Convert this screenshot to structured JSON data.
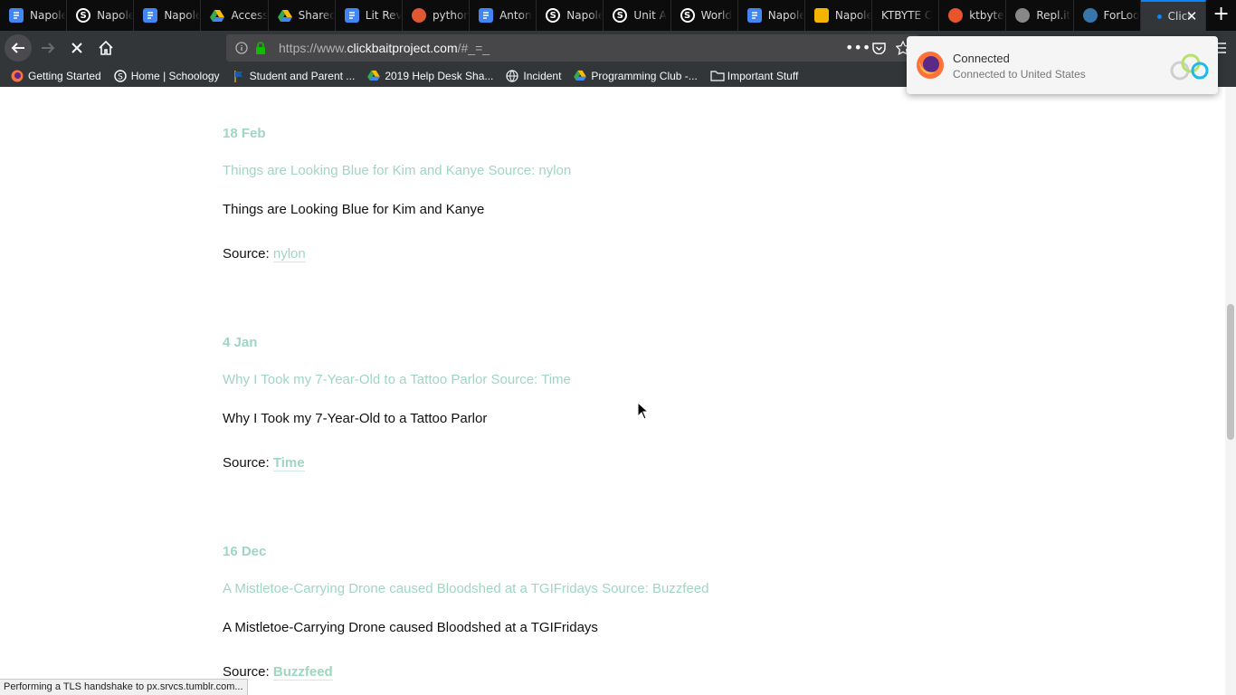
{
  "tabs": [
    {
      "title": "Napole",
      "icon": "docs-icon",
      "color": "#4285f4"
    },
    {
      "title": "Napole",
      "icon": "schoology-icon",
      "color": "#ffffff"
    },
    {
      "title": "Napole",
      "icon": "docs-icon",
      "color": "#4285f4"
    },
    {
      "title": "Access",
      "icon": "drive-icon",
      "color": "#34a853"
    },
    {
      "title": "Shared",
      "icon": "drive-icon",
      "color": "#34a853"
    },
    {
      "title": "Lit Rev",
      "icon": "docs-icon",
      "color": "#4285f4"
    },
    {
      "title": "python",
      "icon": "duckduckgo-icon",
      "color": "#de5833"
    },
    {
      "title": "Anton",
      "icon": "docs-icon",
      "color": "#4285f4"
    },
    {
      "title": "Napole",
      "icon": "schoology-icon",
      "color": "#ffffff"
    },
    {
      "title": "Unit A",
      "icon": "schoology-icon",
      "color": "#ffffff"
    },
    {
      "title": "World",
      "icon": "schoology-icon",
      "color": "#ffffff"
    },
    {
      "title": "Napole",
      "icon": "docs-icon",
      "color": "#4285f4"
    },
    {
      "title": "Napole",
      "icon": "slides-icon",
      "color": "#f4b400"
    },
    {
      "title": "KTBYTE C",
      "icon": "none",
      "color": "#0c0c0d"
    },
    {
      "title": "ktbyte",
      "icon": "ktbyte-icon",
      "color": "#e8552d"
    },
    {
      "title": "Repl.it",
      "icon": "replit-icon",
      "color": "#888888"
    },
    {
      "title": "ForLoo",
      "icon": "python-icon",
      "color": "#3776ab"
    },
    {
      "title": "Click",
      "icon": "loading-dot-icon",
      "color": "#0a84ff",
      "active": true
    }
  ],
  "nav": {
    "url_prefix": "https://www.",
    "url_host": "clickbaitproject.com",
    "url_suffix": "/#_=_"
  },
  "bookmarks": [
    {
      "label": "Getting Started",
      "icon": "firefox-icon"
    },
    {
      "label": "Home | Schoology",
      "icon": "schoology-icon"
    },
    {
      "label": "Student and Parent ...",
      "icon": "flag-icon"
    },
    {
      "label": "2019 Help Desk Sha...",
      "icon": "drive-icon"
    },
    {
      "label": "Incident",
      "icon": "globe-icon"
    },
    {
      "label": "Programming Club -...",
      "icon": "drive-icon"
    },
    {
      "label": "Important Stuff",
      "icon": "folder-icon"
    }
  ],
  "posts": [
    {
      "date": "18 Feb",
      "title": "Things are Looking Blue for Kim and Kanye Source: nylon",
      "body": "Things are Looking Blue for Kim and Kanye",
      "source_label": "Source:",
      "source_link": "nylon",
      "bold_link": false
    },
    {
      "date": "4 Jan",
      "title": "Why I Took my 7-Year-Old to a Tattoo Parlor Source: Time",
      "body": "Why I Took my 7-Year-Old to a Tattoo Parlor",
      "source_label": "Source:",
      "source_link": "Time",
      "bold_link": true
    },
    {
      "date": "16 Dec",
      "title": "A Mistletoe-Carrying Drone caused Bloodshed at a TGIFridays Source: Buzzfeed",
      "body": "A Mistletoe-Carrying Drone caused Bloodshed at a TGIFridays",
      "source_label": "Source:",
      "source_link": "Buzzfeed",
      "bold_link": true
    }
  ],
  "vpn": {
    "title": "Connected",
    "subtitle": "Connected to United States"
  },
  "status_text": "Performing a TLS handshake to px.srvcs.tumblr.com...",
  "colors": {
    "accent": "#9fd6c0",
    "tab_active": "#0a84ff"
  }
}
